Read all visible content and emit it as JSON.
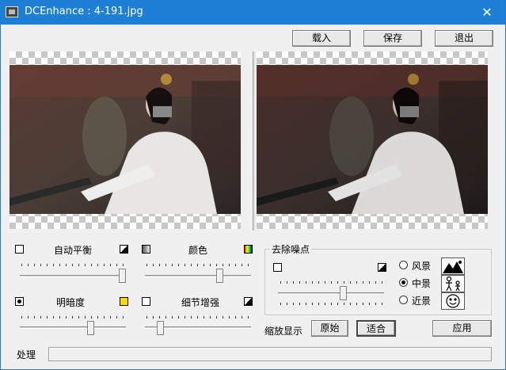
{
  "window": {
    "title": "DCEnhance : 4-191.jpg",
    "close_glyph": "✕"
  },
  "toolbar": {
    "load": "载入",
    "save": "保存",
    "exit": "退出"
  },
  "controls": {
    "auto_balance": "自动平衡",
    "color": "颜色",
    "brightness": "明暗度",
    "detail": "细节增强",
    "denoise": {
      "title": "去除噪点",
      "options": [
        {
          "label": "风景",
          "selected": false,
          "icon": "landscape-icon"
        },
        {
          "label": "中景",
          "selected": true,
          "icon": "people-icon"
        },
        {
          "label": "近景",
          "selected": false,
          "icon": "face-icon"
        }
      ]
    },
    "zoom_label": "缩放显示",
    "zoom_original": "原始",
    "zoom_fit": "适合",
    "apply": "应用"
  },
  "status": {
    "label": "处理"
  },
  "sliders": {
    "auto_balance": 1.0,
    "color": 0.72,
    "brightness": 0.68,
    "detail": 0.12,
    "denoise": 0.62
  }
}
